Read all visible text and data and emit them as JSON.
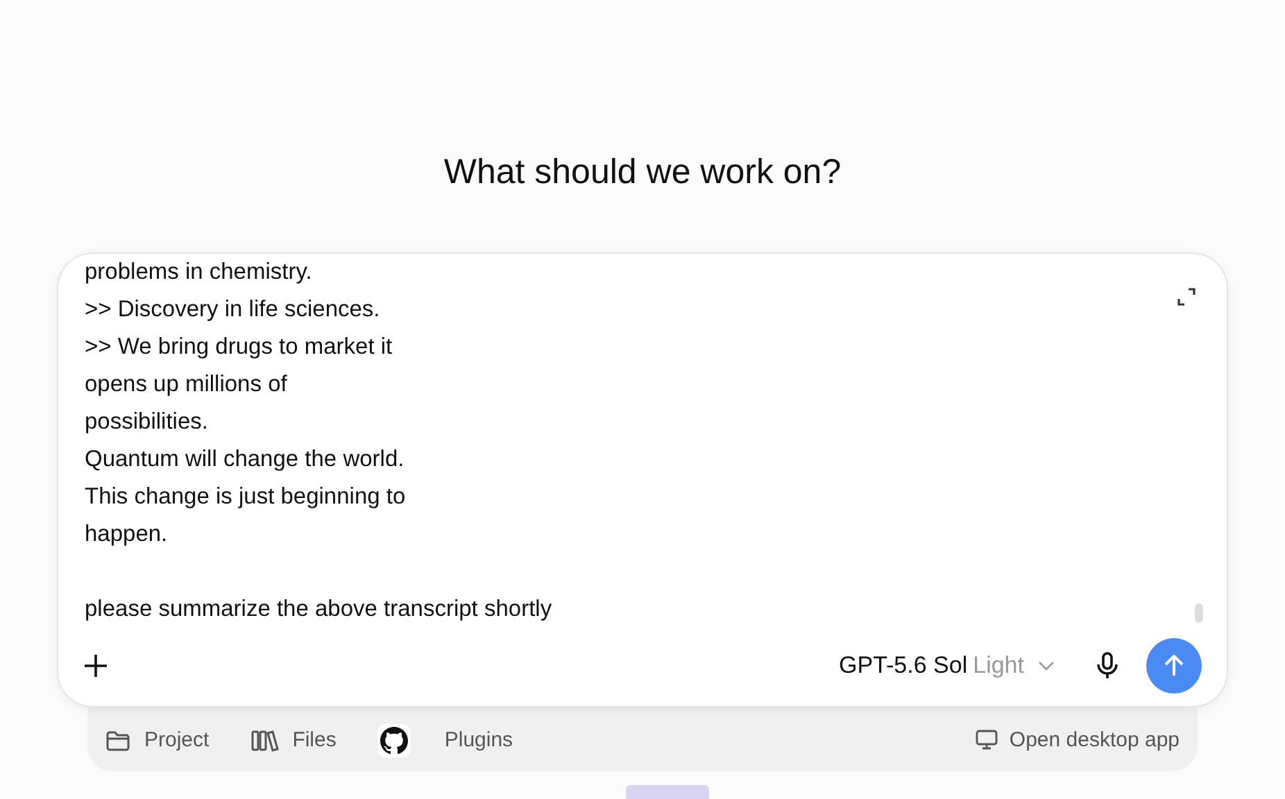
{
  "title": "What should we work on?",
  "composer": {
    "transcript": "problems in chemistry.\n>> Discovery in life sciences.\n>> We bring drugs to market it\nopens up millions of\npossibilities.\nQuantum will change the world.\nThis change is just beginning to\nhappen.",
    "prompt": "please summarize the above transcript shortly",
    "model": {
      "name": "GPT-5.6 Sol",
      "variant": "Light"
    }
  },
  "bottom_bar": {
    "items": [
      {
        "kind": "folder",
        "label": "Project"
      },
      {
        "kind": "books",
        "label": "Files"
      },
      {
        "kind": "github",
        "label": "Plugins"
      }
    ],
    "desktop_link": "Open desktop app"
  }
}
